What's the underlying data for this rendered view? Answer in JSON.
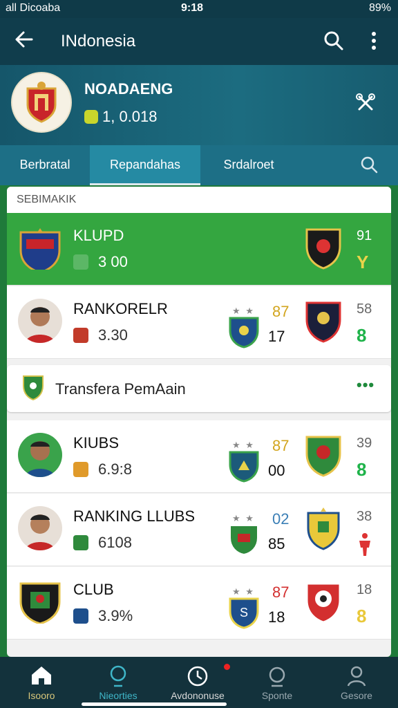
{
  "status": {
    "left": "all Dicoaba",
    "time": "9:18",
    "battery": "89%"
  },
  "appbar": {
    "title": "INdonesia",
    "back_icon": "arrow-left-icon",
    "search_icon": "search-icon",
    "more_icon": "more-vert-icon"
  },
  "hero": {
    "club_name": "NOADAENG",
    "value": "1, 0.018",
    "tool_icon": "tools-icon"
  },
  "tabs": [
    {
      "label": "Berbratal"
    },
    {
      "label": "Repandahas"
    },
    {
      "label": "Srdalroet"
    }
  ],
  "section": {
    "label": "SEBIMAKIK"
  },
  "rows": [
    {
      "name": "KLUPD",
      "sub": "3 00",
      "rank": "",
      "score": "",
      "num": "91",
      "mini": "Y"
    },
    {
      "name": "RANKORELR",
      "sub": "3.30",
      "rank": "87",
      "score": "17",
      "num": "58",
      "mini": "8"
    },
    {
      "name": "KIUBS",
      "sub": "6.9:8",
      "rank": "87",
      "score": "00",
      "num": "39",
      "mini": "8"
    },
    {
      "name": "RANKING LLUBS",
      "sub": "6108",
      "rank": "02",
      "score": "85",
      "num": "38",
      "mini": ""
    },
    {
      "name": "CLUB",
      "sub": "3.9%",
      "rank": "87",
      "score": "18",
      "num": "18",
      "mini": "8"
    }
  ],
  "transfer": {
    "label": "Transfera PemAain",
    "more": "•••"
  },
  "nav": [
    {
      "label": "Isooro"
    },
    {
      "label": "Nieorties"
    },
    {
      "label": "Avdononuse"
    },
    {
      "label": "Sponte"
    },
    {
      "label": "Gesore"
    }
  ],
  "colors": {
    "accent_green": "#34a640",
    "header": "#103d4c",
    "tab": "#1d6f86"
  }
}
